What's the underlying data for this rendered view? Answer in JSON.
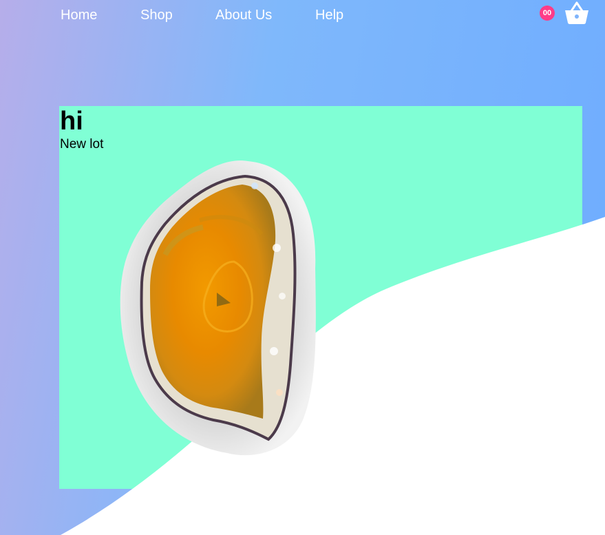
{
  "nav": {
    "links": [
      {
        "label": "Home"
      },
      {
        "label": "Shop"
      },
      {
        "label": "About Us"
      },
      {
        "label": "Help"
      }
    ]
  },
  "cart": {
    "count": "00",
    "icon": "basket-icon",
    "badge_color": "#ff3c88"
  },
  "card": {
    "title": "hi",
    "subtitle": "New lot",
    "background": "#80ffd5"
  },
  "product_image": {
    "icon": "agate-slice-image"
  },
  "colors": {
    "gradient_start": "#b6aeea",
    "gradient_end": "#6eacff",
    "wave": "#ffffff"
  }
}
